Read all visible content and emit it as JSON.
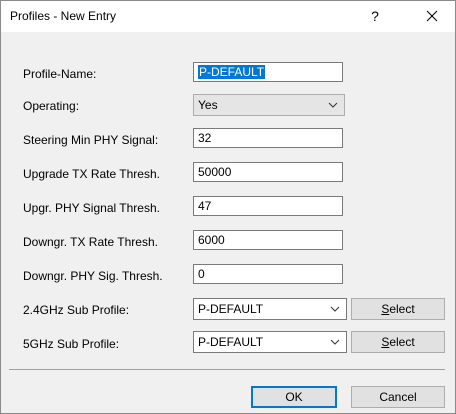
{
  "window": {
    "title": "Profiles - New Entry",
    "help_label": "?"
  },
  "fields": {
    "profile_name": {
      "label": "Profile-Name:",
      "value": "P-DEFAULT"
    },
    "operating": {
      "label": "Operating:",
      "value": "Yes"
    },
    "steering_min_phy_signal": {
      "label": "Steering Min PHY Signal:",
      "value": "32"
    },
    "upgrade_tx_rate_thresh": {
      "label": "Upgrade TX Rate Thresh.",
      "value": "50000"
    },
    "upgr_phy_signal_thresh": {
      "label": "Upgr. PHY Signal Thresh.",
      "value": "47"
    },
    "downgr_tx_rate_thresh": {
      "label": "Downgr. TX Rate Thresh.",
      "value": "6000"
    },
    "downgr_phy_sig_thresh": {
      "label": "Downgr. PHY Sig. Thresh.",
      "value": "0"
    },
    "sub_profile_24ghz": {
      "label": "2.4GHz Sub Profile:",
      "value": "P-DEFAULT",
      "select_label_first": "S",
      "select_label_rest": "elect"
    },
    "sub_profile_5ghz": {
      "label": "5GHz Sub Profile:",
      "value": "P-DEFAULT",
      "select_label_first": "S",
      "select_label_rest": "elect"
    }
  },
  "footer": {
    "ok_label": "OK",
    "cancel_label": "Cancel"
  },
  "colors": {
    "selection": "#0078d7",
    "dialog_bg": "#f0f0f0"
  },
  "icons": {
    "close": "close-icon",
    "dropdown": "chevron-down-icon"
  }
}
